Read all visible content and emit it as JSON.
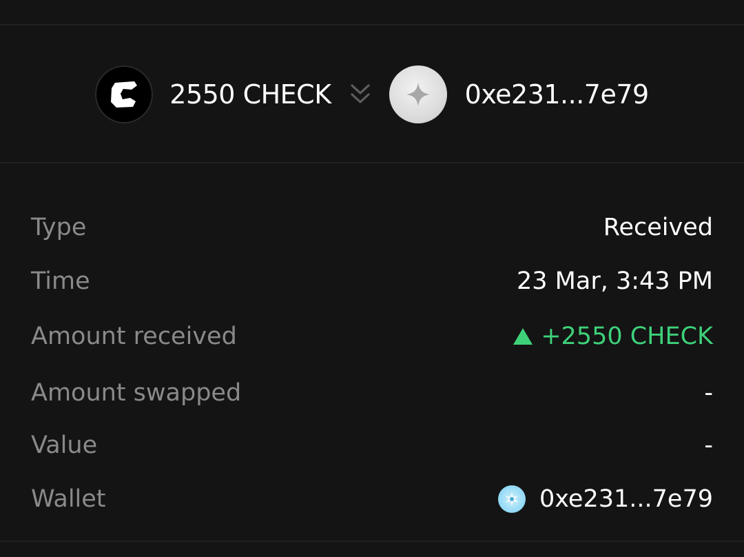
{
  "transfer": {
    "token_icon": "check-token-logo",
    "token_amount": "2550 CHECK",
    "direction_icon": "double-chevron-down-icon",
    "wallet_icon": "sparkle-avatar",
    "wallet_address": "0xe231...7e79"
  },
  "details": {
    "type": {
      "label": "Type",
      "value": "Received"
    },
    "time": {
      "label": "Time",
      "value": "23 Mar, 3:43 PM"
    },
    "amount_received": {
      "label": "Amount received",
      "value": "+2550 CHECK",
      "trend_icon": "triangle-up-icon"
    },
    "amount_swapped": {
      "label": "Amount swapped",
      "value": "-"
    },
    "value": {
      "label": "Value",
      "value": "-"
    },
    "wallet": {
      "label": "Wallet",
      "value": "0xe231...7e79",
      "avatar_icon": "wallet-avatar-icon"
    }
  },
  "colors": {
    "background": "#141414",
    "label": "#8a8a8a",
    "positive": "#3ed17a",
    "divider": "#222222"
  }
}
